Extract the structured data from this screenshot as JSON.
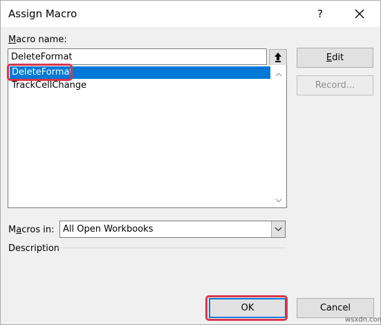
{
  "window": {
    "title": "Assign Macro",
    "help": "?"
  },
  "macro_name": {
    "label_prefix": "",
    "label_underline": "M",
    "label_rest": "acro name:",
    "value": "DeleteFormat"
  },
  "macros": [
    {
      "name": "DeleteFormat",
      "selected": true
    },
    {
      "name": "TrackCellChange",
      "selected": false
    }
  ],
  "buttons": {
    "edit_underline": "E",
    "edit_rest": "dit",
    "record": "Record...",
    "ok": "OK",
    "cancel": "Cancel"
  },
  "macros_in": {
    "label_prefix": "M",
    "label_underline": "a",
    "label_rest": "cros in:",
    "value": "All Open Workbooks"
  },
  "description": {
    "label": "Description"
  },
  "watermark": "wsxdn.com",
  "colors": {
    "selection": "#0078d7",
    "highlight": "#d9364a"
  }
}
